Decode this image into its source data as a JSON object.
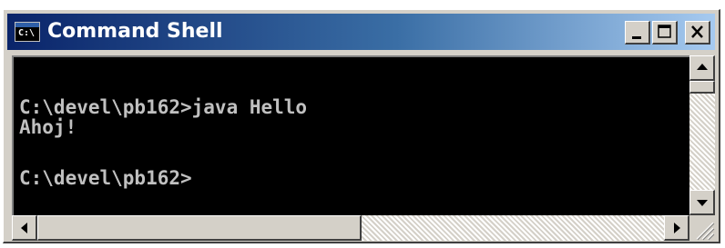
{
  "window": {
    "title": "Command Shell",
    "icon_label": "C:\\",
    "controls": {
      "minimize": "minimize-icon",
      "maximize": "maximize-icon",
      "close": "close-icon"
    }
  },
  "console": {
    "lines": [
      "",
      "C:\\devel\\pb162>java Hello",
      "Ahoj!",
      "",
      "C:\\devel\\pb162>"
    ],
    "background": "#000000",
    "foreground": "#c0c0c0"
  },
  "scrollbars": {
    "vertical": {
      "up": "scroll-up-arrow-icon",
      "down": "scroll-down-arrow-icon"
    },
    "horizontal": {
      "left": "scroll-left-arrow-icon",
      "right": "scroll-right-arrow-icon"
    }
  },
  "colors": {
    "titlebar_start": "#0a246a",
    "titlebar_end": "#a6caf0",
    "chrome": "#d4d0c8"
  }
}
